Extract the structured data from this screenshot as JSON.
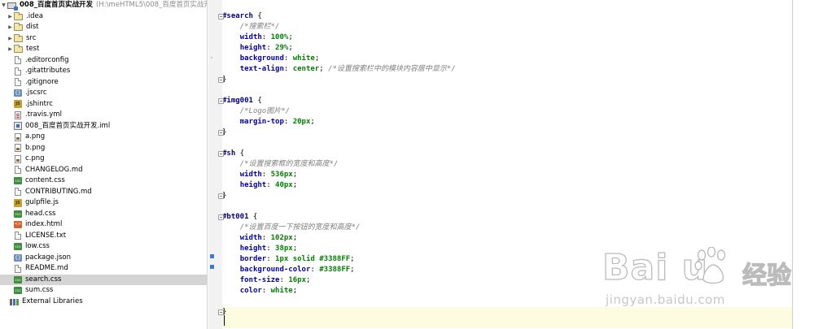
{
  "tree": {
    "project_name": "008_百度首页实战开发",
    "project_path": "(H:\\meHTML5\\008_百度首页实战开发)",
    "items": [
      {
        "label": ".idea",
        "kind": "folder",
        "expandable": true
      },
      {
        "label": "dist",
        "kind": "folder",
        "expandable": true
      },
      {
        "label": "src",
        "kind": "folder",
        "expandable": true
      },
      {
        "label": "test",
        "kind": "folder",
        "expandable": true
      },
      {
        "label": ".editorconfig",
        "kind": "file"
      },
      {
        "label": ".gitattributes",
        "kind": "file"
      },
      {
        "label": ".gitignore",
        "kind": "file"
      },
      {
        "label": ".jscsrc",
        "kind": "json"
      },
      {
        "label": ".jshintrc",
        "kind": "js"
      },
      {
        "label": ".travis.yml",
        "kind": "yml"
      },
      {
        "label": "008_百度首页实战开发.iml",
        "kind": "iml"
      },
      {
        "label": "a.png",
        "kind": "img"
      },
      {
        "label": "b.png",
        "kind": "img"
      },
      {
        "label": "c.png",
        "kind": "img"
      },
      {
        "label": "CHANGELOG.md",
        "kind": "file"
      },
      {
        "label": "content.css",
        "kind": "css"
      },
      {
        "label": "CONTRIBUTING.md",
        "kind": "file"
      },
      {
        "label": "gulpfile.js",
        "kind": "js"
      },
      {
        "label": "head.css",
        "kind": "css"
      },
      {
        "label": "index.html",
        "kind": "html"
      },
      {
        "label": "LICENSE.txt",
        "kind": "file"
      },
      {
        "label": "low.css",
        "kind": "css"
      },
      {
        "label": "package.json",
        "kind": "json"
      },
      {
        "label": "README.md",
        "kind": "file"
      },
      {
        "label": "search.css",
        "kind": "css",
        "selected": true
      },
      {
        "label": "sum.css",
        "kind": "css"
      }
    ],
    "external": "External Libraries"
  },
  "code": {
    "l1": {
      "sel": "#search",
      "brace": " {"
    },
    "l2": {
      "cmt": "/*搜索栏*/"
    },
    "l3": {
      "prop": "width",
      "val": "100%",
      "end": ";"
    },
    "l4": {
      "prop": "height",
      "val": "29%",
      "end": ";"
    },
    "l5": {
      "prop": "background",
      "val": "white",
      "end": ";"
    },
    "l6": {
      "prop": "text-align",
      "val": "center",
      "end": ";",
      "cmt": " /*设置搜索栏中的模块内容居中显示*/"
    },
    "l7": {
      "brace": "}"
    },
    "l9": {
      "sel": "#img001",
      "brace": " {"
    },
    "l10": {
      "cmt": "/*Logo图片*/"
    },
    "l11": {
      "prop": "margin-top",
      "val": "20px",
      "end": ";"
    },
    "l12": {
      "brace": "}"
    },
    "l14": {
      "sel": "#sh",
      "brace": " {"
    },
    "l15": {
      "cmt": "/*设置搜索框的宽度和高度*/"
    },
    "l16": {
      "prop": "width",
      "val": "536px",
      "end": ";"
    },
    "l17": {
      "prop": "height",
      "val": "40px",
      "end": ";"
    },
    "l18": {
      "brace": "}"
    },
    "l20": {
      "sel": "#bt001",
      "brace": " {"
    },
    "l21": {
      "cmt": "/*设置百度一下按钮的宽度和高度*/"
    },
    "l22": {
      "prop": "width",
      "val": "102px",
      "end": ";"
    },
    "l23": {
      "prop": "height",
      "val": "38px",
      "end": ";"
    },
    "l24": {
      "prop": "border",
      "val": "1px solid #3388FF",
      "end": ";"
    },
    "l25": {
      "prop": "background-color",
      "val": "#3388FF",
      "end": ";"
    },
    "l26": {
      "prop": "font-size",
      "val": "16px",
      "end": ";"
    },
    "l27": {
      "prop": "color",
      "val": "white",
      "end": ";"
    },
    "l29": {
      "brace": "}"
    }
  },
  "watermark": {
    "brand": "Bai  u",
    "cn": "经验",
    "url": "jingyan.baidu.com"
  },
  "colors": {
    "accent": "#3388FF",
    "selector": "#000080",
    "property": "#0000aa",
    "value": "#008000",
    "comment": "#808080",
    "gutter_mark": "#3b7bd4"
  }
}
